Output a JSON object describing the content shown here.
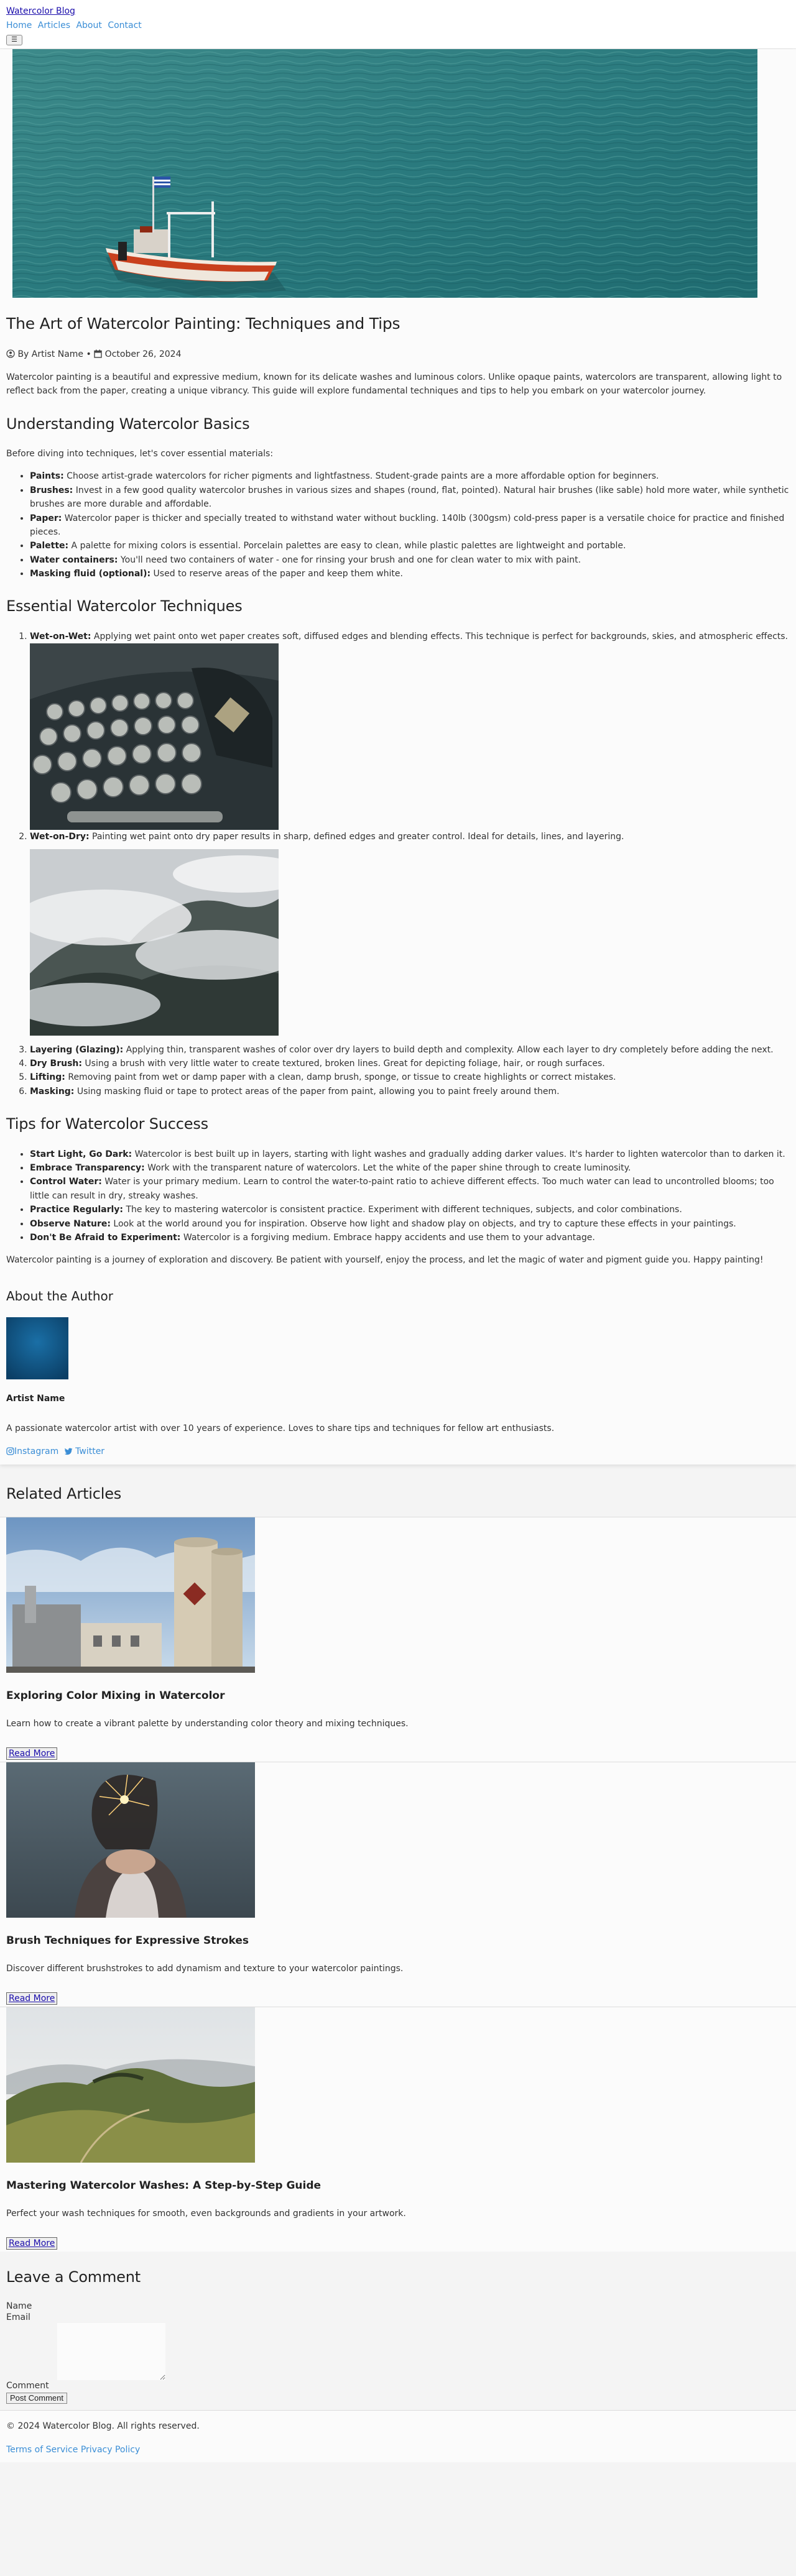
{
  "header": {
    "brand": "Watercolor Blog",
    "nav": [
      "Home",
      "Articles",
      "About",
      "Contact"
    ],
    "menu_icon": "hamburger-icon"
  },
  "article": {
    "title": "The Art of Watercolor Painting: Techniques and Tips",
    "author": "By Artist Name",
    "date": "October 26, 2024",
    "intro": "Watercolor painting is a beautiful and expressive medium, known for its delicate washes and luminous colors. Unlike opaque paints, watercolors are transparent, allowing light to reflect back from the paper, creating a unique vibrancy. This guide will explore fundamental techniques and tips to help you embark on your watercolor journey.",
    "basics": {
      "heading": "Understanding Watercolor Basics",
      "lead": "Before diving into techniques, let's cover essential materials:",
      "items": [
        {
          "term": "Paints:",
          "text": " Choose artist-grade watercolors for richer pigments and lightfastness. Student-grade paints are a more affordable option for beginners."
        },
        {
          "term": "Brushes:",
          "text": " Invest in a few good quality watercolor brushes in various sizes and shapes (round, flat, pointed). Natural hair brushes (like sable) hold more water, while synthetic brushes are more durable and affordable."
        },
        {
          "term": "Paper:",
          "text": " Watercolor paper is thicker and specially treated to withstand water without buckling. 140lb (300gsm) cold-press paper is a versatile choice for practice and finished pieces."
        },
        {
          "term": "Palette:",
          "text": " A palette for mixing colors is essential. Porcelain palettes are easy to clean, while plastic palettes are lightweight and portable."
        },
        {
          "term": "Water containers:",
          "text": " You'll need two containers of water - one for rinsing your brush and one for clean water to mix with paint."
        },
        {
          "term": "Masking fluid (optional):",
          "text": " Used to reserve areas of the paper and keep them white."
        }
      ]
    },
    "techniques": {
      "heading": "Essential Watercolor Techniques",
      "items": [
        {
          "term": "Wet-on-Wet:",
          "text": " Applying wet paint onto wet paper creates soft, diffused edges and blending effects. This technique is perfect for backgrounds, skies, and atmospheric effects."
        },
        {
          "term": "Wet-on-Dry:",
          "text": " Painting wet paint onto dry paper results in sharp, defined edges and greater control. Ideal for details, lines, and layering."
        },
        {
          "term": "Layering (Glazing):",
          "text": " Applying thin, transparent washes of color over dry layers to build depth and complexity. Allow each layer to dry completely before adding the next."
        },
        {
          "term": "Dry Brush:",
          "text": " Using a brush with very little water to create textured, broken lines. Great for depicting foliage, hair, or rough surfaces."
        },
        {
          "term": "Lifting:",
          "text": " Removing paint from wet or damp paper with a clean, damp brush, sponge, or tissue to create highlights or correct mistakes."
        },
        {
          "term": "Masking:",
          "text": " Using masking fluid or tape to protect areas of the paper from paint, allowing you to paint freely around them."
        }
      ]
    },
    "tips": {
      "heading": "Tips for Watercolor Success",
      "items": [
        {
          "term": "Start Light, Go Dark:",
          "text": " Watercolor is best built up in layers, starting with light washes and gradually adding darker values. It's harder to lighten watercolor than to darken it."
        },
        {
          "term": "Embrace Transparency:",
          "text": " Work with the transparent nature of watercolors. Let the white of the paper shine through to create luminosity."
        },
        {
          "term": "Control Water:",
          "text": " Water is your primary medium. Learn to control the water-to-paint ratio to achieve different effects. Too much water can lead to uncontrolled blooms; too little can result in dry, streaky washes."
        },
        {
          "term": "Practice Regularly:",
          "text": " The key to mastering watercolor is consistent practice. Experiment with different techniques, subjects, and color combinations."
        },
        {
          "term": "Observe Nature:",
          "text": " Look at the world around you for inspiration. Observe how light and shadow play on objects, and try to capture these effects in your paintings."
        },
        {
          "term": "Don't Be Afraid to Experiment:",
          "text": " Watercolor is a forgiving medium. Embrace happy accidents and use them to your advantage."
        }
      ]
    },
    "conclusion": "Watercolor painting is a journey of exploration and discovery. Be patient with yourself, enjoy the process, and let the magic of water and pigment guide you. Happy painting!"
  },
  "author_box": {
    "heading": "About the Author",
    "name": "Artist Name",
    "bio": "A passionate watercolor artist with over 10 years of experience. Loves to share tips and techniques for fellow art enthusiasts.",
    "instagram": "Instagram",
    "twitter": "Twitter"
  },
  "related": {
    "heading": "Related Articles",
    "read_more": "Read More",
    "cards": [
      {
        "title": "Exploring Color Mixing in Watercolor",
        "excerpt": "Learn how to create a vibrant palette by understanding color theory and mixing techniques."
      },
      {
        "title": "Brush Techniques for Expressive Strokes",
        "excerpt": "Discover different brushstrokes to add dynamism and texture to your watercolor paintings."
      },
      {
        "title": "Mastering Watercolor Washes: A Step-by-Step Guide",
        "excerpt": "Perfect your wash techniques for smooth, even backgrounds and gradients in your artwork."
      }
    ]
  },
  "comments": {
    "heading": "Leave a Comment",
    "name_label": "Name",
    "email_label": "Email",
    "comment_label": "Comment",
    "submit": "Post Comment"
  },
  "footer": {
    "copyright": "© 2024 Watercolor Blog. All rights reserved.",
    "terms": "Terms of Service",
    "privacy": "Privacy Policy"
  },
  "colors": {
    "link": "#3b8ed6",
    "page_bg": "#f4f4f4",
    "card_bg": "#fbfbfb",
    "visited_link": "#1a0dab"
  }
}
